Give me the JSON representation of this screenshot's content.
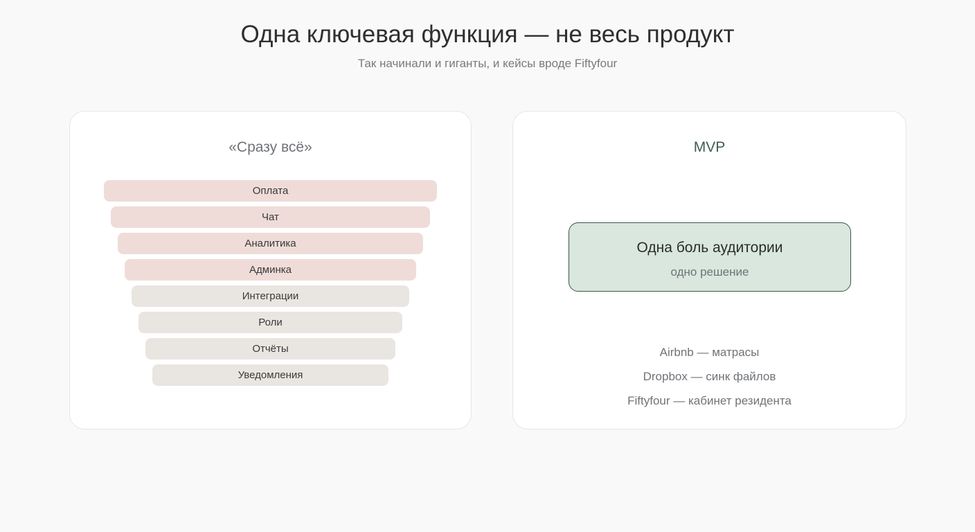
{
  "header": {
    "title": "Одна ключевая функция — не весь продукт",
    "subtitle": "Так начинали и гиганты, и кейсы вроде Fiftyfour"
  },
  "left_card": {
    "title": "«Сразу всё»",
    "features": [
      {
        "label": "Оплата",
        "tone": "pink"
      },
      {
        "label": "Чат",
        "tone": "pink"
      },
      {
        "label": "Аналитика",
        "tone": "pink"
      },
      {
        "label": "Админка",
        "tone": "pink"
      },
      {
        "label": "Интеграции",
        "tone": "gray"
      },
      {
        "label": "Роли",
        "tone": "gray"
      },
      {
        "label": "Отчёты",
        "tone": "gray"
      },
      {
        "label": "Уведомления",
        "tone": "gray"
      }
    ]
  },
  "right_card": {
    "title": "MVP",
    "solution": {
      "main": "Одна боль аудитории",
      "sub": "одно решение"
    },
    "examples": [
      "Airbnb — матрасы",
      "Dropbox — синк файлов",
      "Fiftyfour — кабинет резидента"
    ]
  },
  "colors": {
    "pink_feature": "#efdcd8",
    "gray_feature": "#e9e6e1",
    "solution_fill": "#d9e7de",
    "solution_border": "#3c5547"
  }
}
